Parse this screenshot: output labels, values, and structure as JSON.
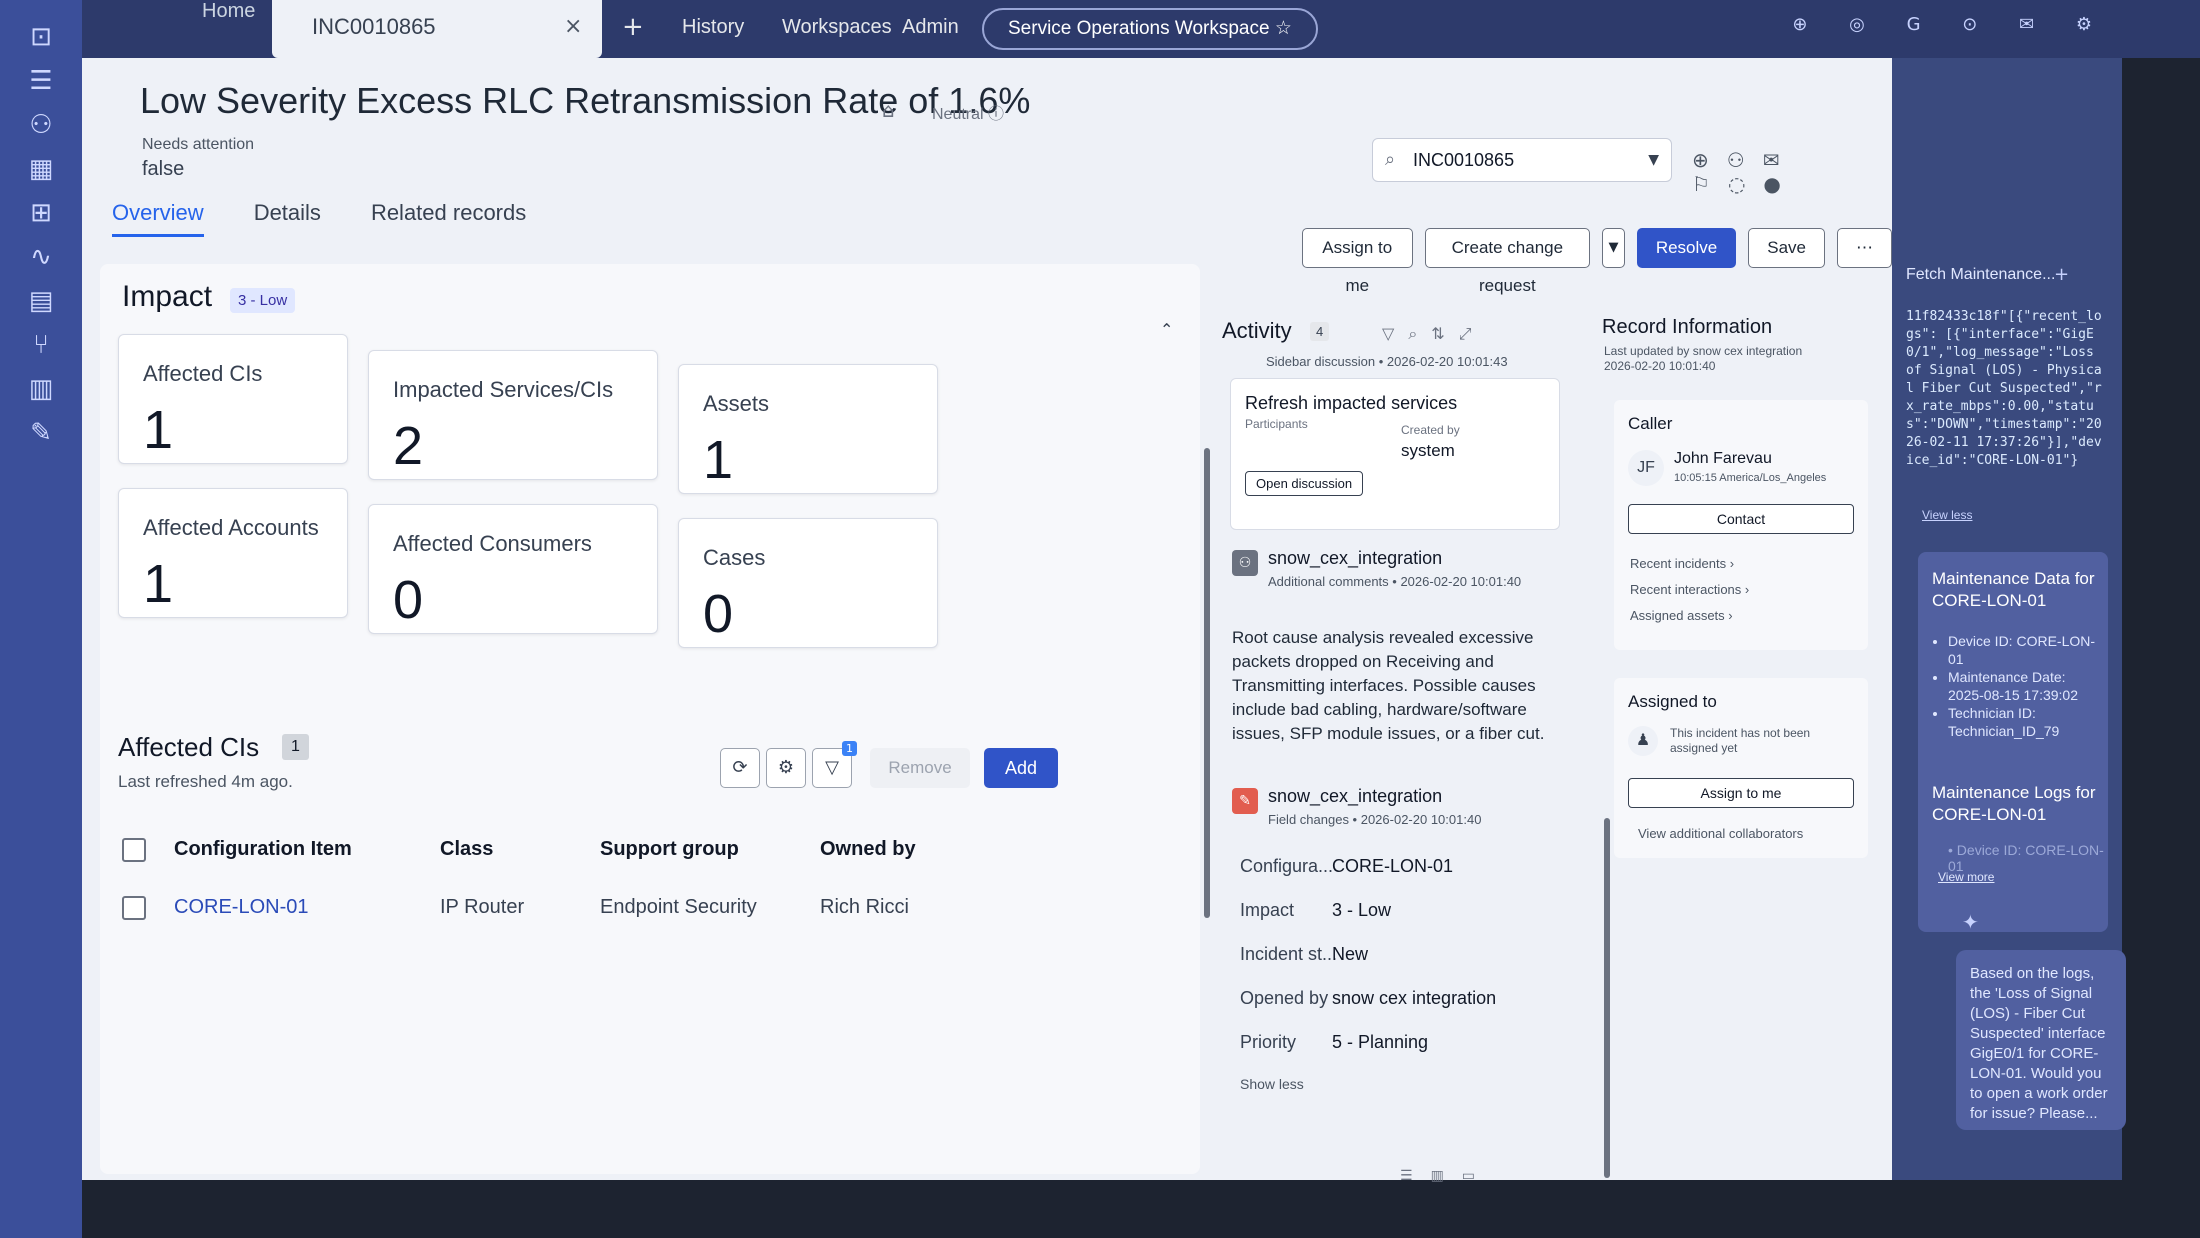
{
  "top_nav": {
    "home_label": "Home",
    "tab_label": "INC0010865",
    "tab_close": "×",
    "add_tab": "+",
    "items": [
      "History",
      "Workspaces",
      "Admin"
    ],
    "workspace_label": "Service Operations Workspace ☆",
    "sys_icons": "⊕ ◎ G ⊙ ✉ ⚙"
  },
  "record": {
    "title": "Low Severity Excess RLC Retransmission Rate of 1.6%",
    "sentiment": "Neutral",
    "needs_attention_label": "Needs attention",
    "needs_attention_value": "false",
    "tabs": [
      "Overview",
      "Details",
      "Related records"
    ]
  },
  "search": {
    "value": "INC0010865"
  },
  "actions": {
    "assign_to_me": "Assign to me",
    "create_change_request": "Create change request",
    "resolve": "Resolve",
    "save": "Save",
    "more": "⋯"
  },
  "impact": {
    "title": "Impact",
    "badge": "3 - Low",
    "cards": [
      {
        "label": "Affected CIs",
        "value": "1"
      },
      {
        "label": "Impacted Services/CIs",
        "value": "2"
      },
      {
        "label": "Assets",
        "value": "1"
      },
      {
        "label": "Affected Accounts",
        "value": "1"
      },
      {
        "label": "Affected Consumers",
        "value": "0"
      },
      {
        "label": "Cases",
        "value": "0"
      }
    ]
  },
  "affected_cis": {
    "title": "Affected CIs",
    "count": "1",
    "refreshed": "Last refreshed 4m ago.",
    "filter_badge": "1",
    "remove_label": "Remove",
    "add_label": "Add",
    "columns": [
      "Configuration Item",
      "Class",
      "Support group",
      "Owned by"
    ],
    "rows": [
      [
        "CORE-LON-01",
        "IP Router",
        "Endpoint Security",
        "Rich Ricci"
      ]
    ]
  },
  "activity": {
    "title": "Activity",
    "count": "4",
    "sidebar_meta": "Sidebar discussion • 2026-02-20 10:01:43",
    "discussion_title": "Refresh impacted services",
    "participants_label": "Participants",
    "created_by_label": "Created by",
    "created_by_value": "system",
    "open_discussion": "Open discussion",
    "entry1_name": "snow_cex_integration",
    "entry1_meta": "Additional comments • 2026-02-20 10:01:40",
    "entry1_body": "Root cause analysis revealed excessive packets dropped on Receiving and Transmitting interfaces. Possible causes include bad cabling, hardware/software issues, SFP module issues, or a fiber cut.",
    "entry2_name": "snow_cex_integration",
    "entry2_meta": "Field changes • 2026-02-20 10:01:40",
    "field_changes": [
      {
        "label": "Configura...",
        "value": "CORE-LON-01"
      },
      {
        "label": "Impact",
        "value": "3 - Low"
      },
      {
        "label": "Incident st...",
        "value": "New"
      },
      {
        "label": "Opened by",
        "value": "snow cex integration"
      },
      {
        "label": "Priority",
        "value": "5 - Planning"
      }
    ],
    "show_less": "Show less"
  },
  "record_info": {
    "title": "Record Information",
    "subtitle": "Last updated by snow cex integration 2026-02-20 10:01:40",
    "caller_label": "Caller",
    "caller_initials": "JF",
    "caller_name": "John Farevau",
    "caller_time": "10:05:15 America/Los_Angeles",
    "contact_label": "Contact",
    "links": [
      "Recent incidents ›",
      "Recent interactions ›",
      "Assigned assets ›"
    ],
    "assigned_label": "Assigned to",
    "assigned_note": "This incident has not been assigned yet",
    "assign_btn": "Assign to me",
    "collaborators_link": "View additional collaborators"
  },
  "assistant": {
    "header": "Fetch Maintenance...",
    "code": "11f82433c18f\"[{\"recent_logs\": [{\"interface\":\"GigE0/1\",\"log_message\":\"Loss of Signal (LOS) - Physical Fiber Cut Suspected\",\"rx_rate_mbps\":0.00,\"status\":\"DOWN\",\"timestamp\":\"2026-02-11 17:37:26\"}],\"device_id\":\"CORE-LON-01\"}",
    "view_less": "View less",
    "card_title": "Maintenance Data for CORE-LON-01",
    "card_items": [
      "Device ID: CORE-LON-01",
      "Maintenance Date: 2025-08-15 17:39:02",
      "Technician ID: Technician_ID_79"
    ],
    "card_title2": "Maintenance Logs for CORE-LON-01",
    "card_faded": "• Device ID: CORE-LON-01",
    "view_more": "View more",
    "message": "Based on the logs, the 'Loss of Signal (LOS) - Fiber Cut Suspected' interface GigE0/1 for CORE-LON-01. Would you to open a work order for issue? Please..."
  }
}
